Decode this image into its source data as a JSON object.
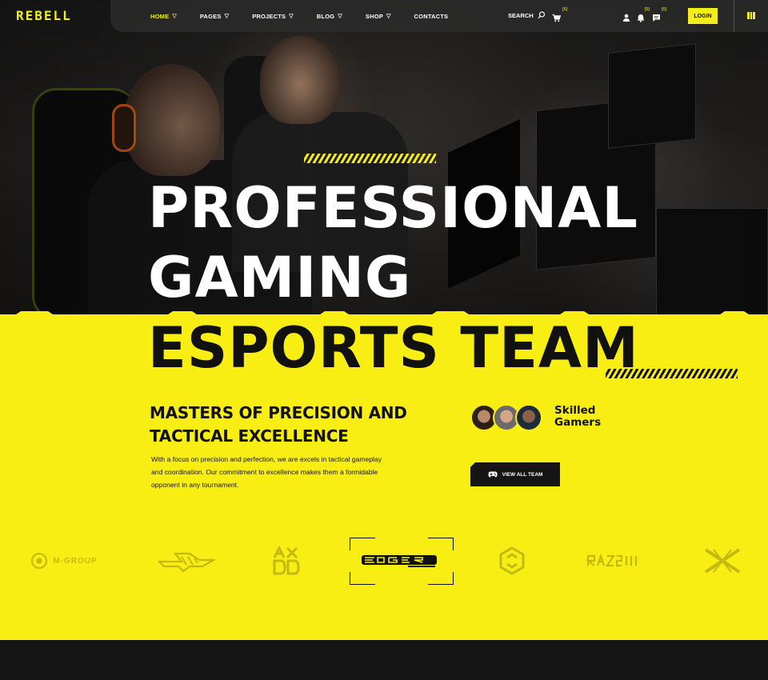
{
  "header": {
    "logo": "REBELL",
    "nav": [
      {
        "label": "HOME",
        "has_dropdown": true,
        "active": true
      },
      {
        "label": "PAGES",
        "has_dropdown": true,
        "active": false
      },
      {
        "label": "PROJECTS",
        "has_dropdown": true,
        "active": false
      },
      {
        "label": "BLOG",
        "has_dropdown": true,
        "active": false
      },
      {
        "label": "SHOP",
        "has_dropdown": true,
        "active": false
      },
      {
        "label": "CONTACTS",
        "has_dropdown": false,
        "active": false
      }
    ],
    "search_label": "SEARCH",
    "cart_count": "[5]",
    "notifications_count": "[5]",
    "messages_count": "[6]",
    "login_label": "LOGIN",
    "icons": [
      "search-icon",
      "cart-icon",
      "user-icon",
      "bell-icon",
      "chat-icon",
      "grid-menu-icon"
    ]
  },
  "hero": {
    "title_line1": "PROFESSIONAL",
    "title_line2": "GAMING",
    "title_line3": "ESPORTS TEAM"
  },
  "about": {
    "subheading": "MASTERS OF PRECISION AND TACTICAL EXCELLENCE",
    "description": "With a focus on precision and perfection, we are excels in tactical gameplay and coordination. Our commitment to excellence makes them a formidable opponent in any tournament.",
    "skilled_label": "Skilled Gamers",
    "team_button_label": "VIEW ALL TEAM"
  },
  "partners": [
    {
      "name": "M-GROUP",
      "active": false
    },
    {
      "name": "ARROW",
      "active": false
    },
    {
      "name": "AXDD",
      "active": false
    },
    {
      "name": "EDGER",
      "active": true
    },
    {
      "name": "HEX",
      "active": false
    },
    {
      "name": "RAZIII",
      "active": false
    },
    {
      "name": "XX",
      "active": false
    }
  ],
  "colors": {
    "accent": "#f3ed19",
    "section_yellow": "#f9ee14",
    "dark": "#151515"
  }
}
